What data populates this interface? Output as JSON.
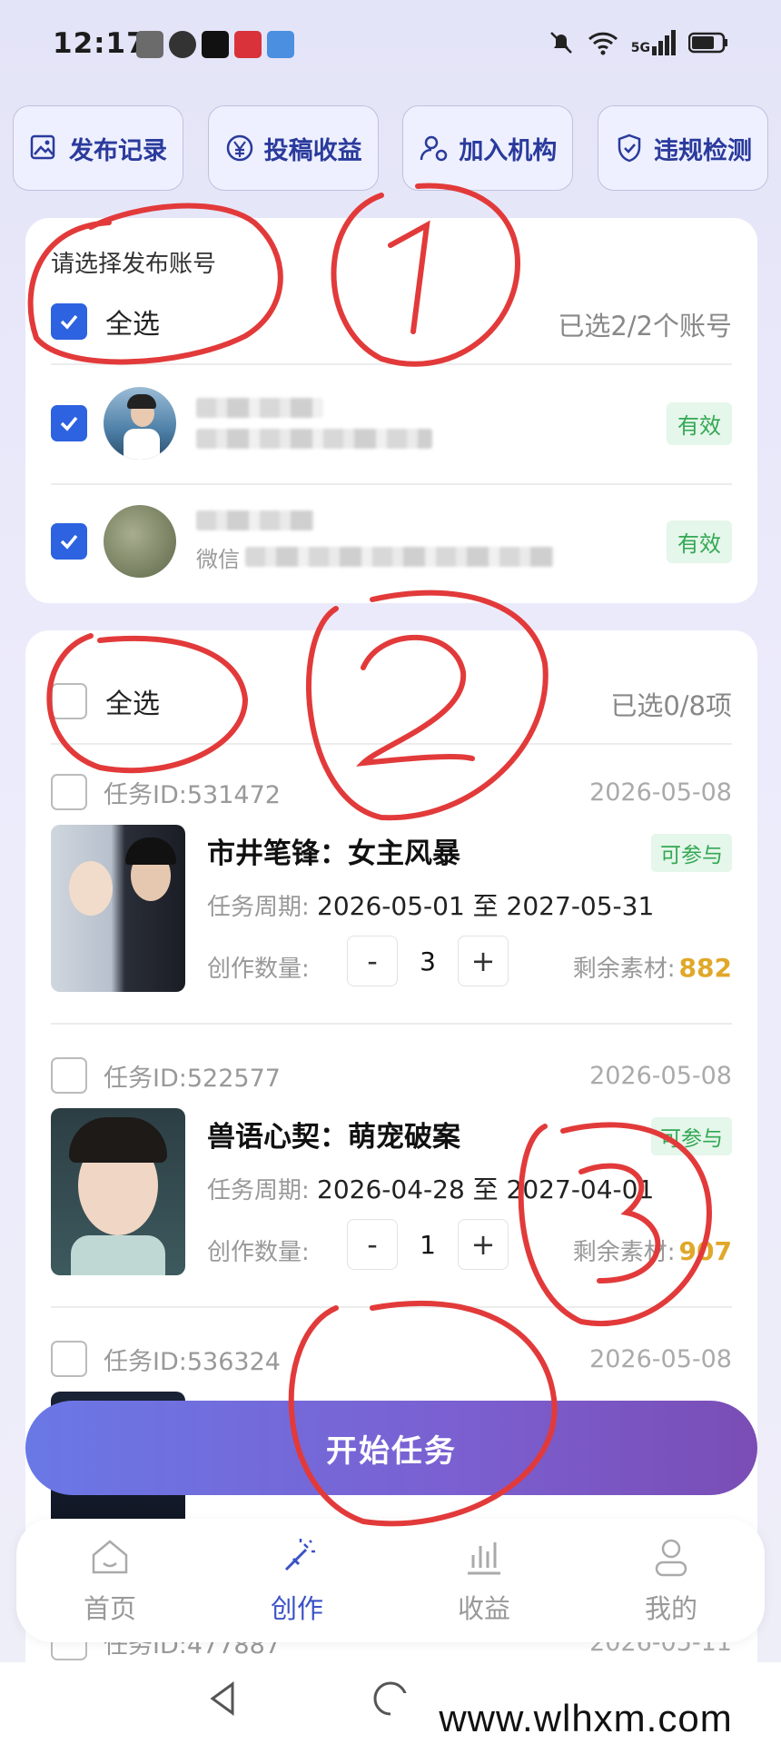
{
  "status_bar": {
    "time": "12:17",
    "network": "5G"
  },
  "toolbar": [
    {
      "label": "发布记录",
      "icon": "image-edit-icon"
    },
    {
      "label": "投稿收益",
      "icon": "yen-icon"
    },
    {
      "label": "加入机构",
      "icon": "user-gear-icon"
    },
    {
      "label": "违规检测",
      "icon": "shield-check-icon"
    }
  ],
  "accounts": {
    "title": "请选择发布账号",
    "select_all": "全选",
    "select_all_checked": true,
    "selected_count": "已选2/2个账号",
    "items": [
      {
        "checked": true,
        "status": "有效"
      },
      {
        "checked": true,
        "sub_prefix": "微信",
        "status": "有效"
      }
    ]
  },
  "tasks": {
    "select_all": "全选",
    "selected_count": "已选0/8项",
    "period_label": "任务周期:",
    "qty_label": "创作数量:",
    "remain_label": "剩余素材:",
    "minus": "-",
    "plus": "+",
    "items": [
      {
        "id": "任务ID:531472",
        "date": "2026-05-08",
        "title": "市井笔锋：女主风暴",
        "badge": "可参与",
        "period": "2026-05-01 至 2027-05-31",
        "qty": "3",
        "remain": "882"
      },
      {
        "id": "任务ID:522577",
        "date": "2026-05-08",
        "title": "兽语心契：萌宠破案",
        "badge": "可参与",
        "period": "2026-04-28 至 2027-04-01",
        "qty": "1",
        "remain": "907"
      },
      {
        "id": "任务ID:536324",
        "date": "2026-05-08"
      },
      {
        "id": "任务ID:477887",
        "date": "2026-05-11"
      }
    ]
  },
  "start_button": "开始任务",
  "bottom_nav": [
    {
      "label": "首页",
      "icon": "home-icon",
      "active": false
    },
    {
      "label": "创作",
      "icon": "magic-wand-icon",
      "active": true
    },
    {
      "label": "收益",
      "icon": "bar-chart-icon",
      "active": false
    },
    {
      "label": "我的",
      "icon": "user-icon",
      "active": false
    }
  ],
  "watermark": "www.wlhxm.com",
  "annotations": [
    "1",
    "2",
    "3"
  ],
  "colors": {
    "accent": "#2d62e0",
    "valid_green": "#32a853",
    "remain_gold": "#e0a82a",
    "annotation_red": "#e23a3a"
  }
}
